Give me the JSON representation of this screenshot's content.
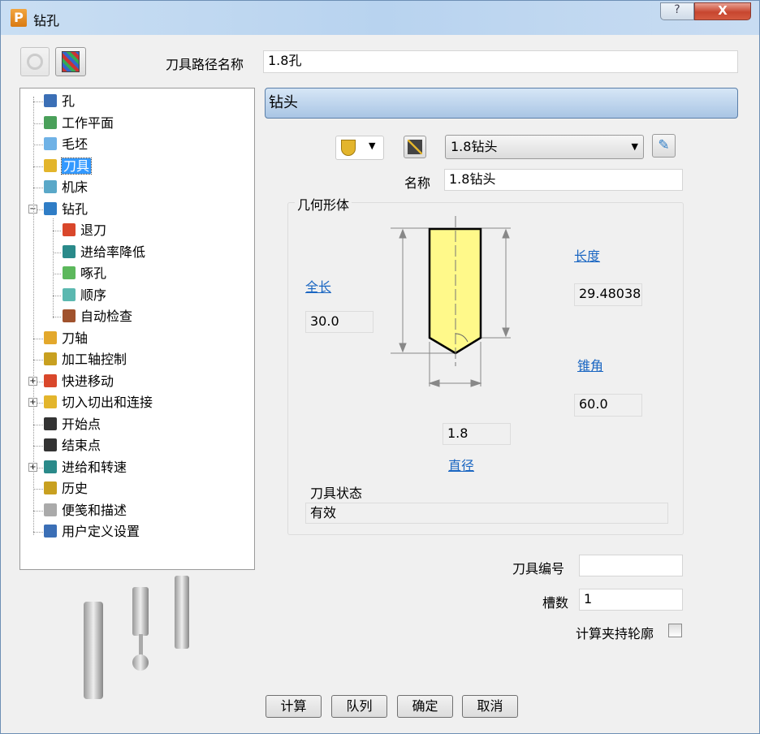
{
  "window": {
    "title": "钻孔",
    "help": "?",
    "close": "X"
  },
  "toolpath_name": {
    "label": "刀具路径名称",
    "value": "1.8孔"
  },
  "tree": [
    {
      "label": "孔",
      "level": 0,
      "color": "#3b6fb6"
    },
    {
      "label": "工作平面",
      "level": 0,
      "color": "#4aa05a"
    },
    {
      "label": "毛坯",
      "level": 0,
      "color": "#6fb2e6"
    },
    {
      "label": "刀具",
      "level": 0,
      "color": "#e3b52c",
      "selected": true
    },
    {
      "label": "机床",
      "level": 0,
      "color": "#5aa8c8"
    },
    {
      "label": "钻孔",
      "level": 0,
      "color": "#2f7dc6",
      "expander": "−"
    },
    {
      "label": "退刀",
      "level": 1,
      "color": "#d9472b"
    },
    {
      "label": "进给率降低",
      "level": 1,
      "color": "#2a8a8a"
    },
    {
      "label": "啄孔",
      "level": 1,
      "color": "#5cb85c"
    },
    {
      "label": "顺序",
      "level": 1,
      "color": "#5bb8b0"
    },
    {
      "label": "自动检查",
      "level": 1,
      "color": "#a0522d"
    },
    {
      "label": "刀轴",
      "level": 0,
      "color": "#e3a82c"
    },
    {
      "label": "加工轴控制",
      "level": 0,
      "color": "#c8a020"
    },
    {
      "label": "快进移动",
      "level": 0,
      "color": "#d9472b",
      "expander": "+"
    },
    {
      "label": "切入切出和连接",
      "level": 0,
      "color": "#e3b52c",
      "expander": "+"
    },
    {
      "label": "开始点",
      "level": 0,
      "color": "#333333"
    },
    {
      "label": "结束点",
      "level": 0,
      "color": "#333333"
    },
    {
      "label": "进给和转速",
      "level": 0,
      "color": "#2a8a8a",
      "expander": "+"
    },
    {
      "label": "历史",
      "level": 0,
      "color": "#c8a020"
    },
    {
      "label": "便笺和描述",
      "level": 0,
      "color": "#aaaaaa"
    },
    {
      "label": "用户定义设置",
      "level": 0,
      "color": "#3b6fb6"
    }
  ],
  "panel": {
    "header": "钻头",
    "tool_select": "1.8钻头",
    "name_label": "名称",
    "name_value": "1.8钻头",
    "geometry_label": "几何形体",
    "overall_length_label": "全长",
    "overall_length": "30.0",
    "length_label": "长度",
    "length": "29.48038",
    "taper_angle_label": "锥角",
    "taper_angle": "60.0",
    "diameter_label": "直径",
    "diameter": "1.8",
    "tool_state_label": "刀具状态",
    "tool_state": "有效",
    "tool_number_label": "刀具编号",
    "tool_number": "",
    "flutes_label": "槽数",
    "flutes": "1",
    "holder_profile_label": "计算夹持轮廓"
  },
  "buttons": {
    "calculate": "计算",
    "queue": "队列",
    "ok": "确定",
    "cancel": "取消"
  }
}
